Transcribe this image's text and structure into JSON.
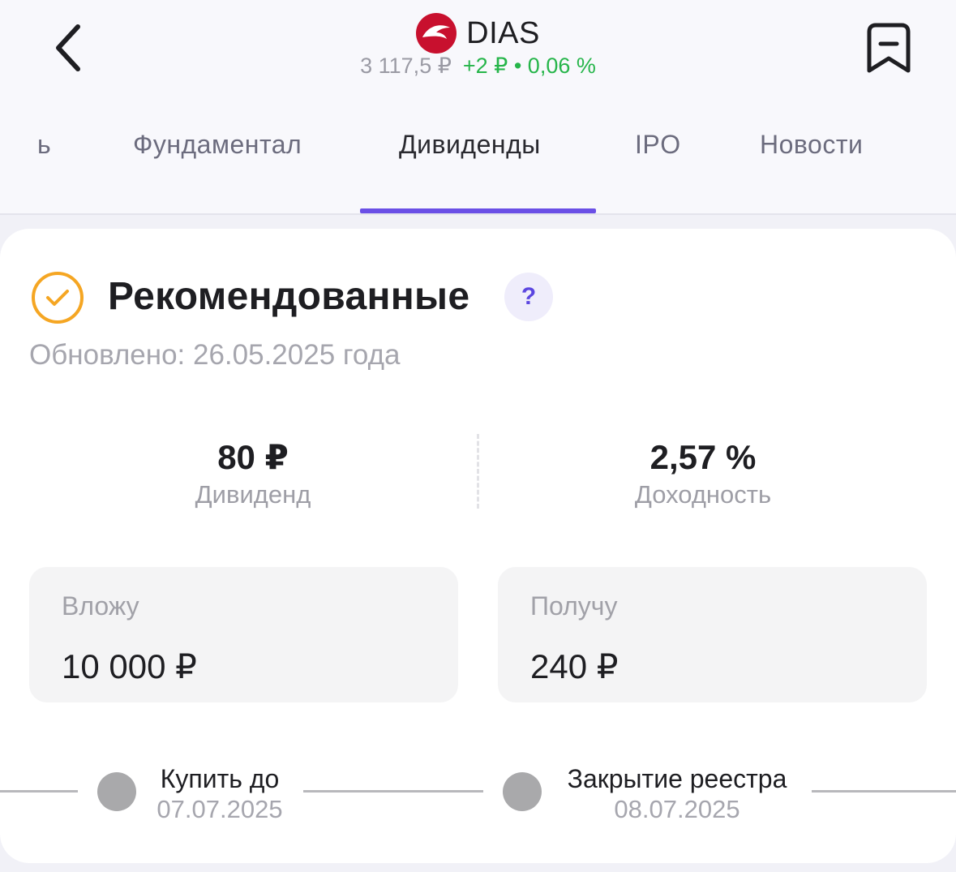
{
  "header": {
    "ticker": "DIAS",
    "price": "3 117,5 ₽",
    "change": "+2 ₽ • 0,06 %",
    "colors": {
      "change": "#26b54a",
      "logo": "#c8102e",
      "accent": "#6a4fe6"
    }
  },
  "tabs": [
    {
      "label": "ь",
      "active": false
    },
    {
      "label": "Фундаментал",
      "active": false
    },
    {
      "label": "Дивиденды",
      "active": true
    },
    {
      "label": "IPO",
      "active": false
    },
    {
      "label": "Новости",
      "active": false
    }
  ],
  "card": {
    "title": "Рекомендованные",
    "help": "?",
    "updated": "Обновлено: 26.05.2025 года",
    "dividend": {
      "value": "80 ₽",
      "label": "Дивиденд"
    },
    "yield": {
      "value": "2,57 %",
      "label": "Доходность"
    },
    "invest": {
      "label": "Вложу",
      "value": "10 000 ₽"
    },
    "receive": {
      "label": "Получу",
      "value": "240 ₽"
    },
    "timeline": [
      {
        "title": "Купить до",
        "date": "07.07.2025"
      },
      {
        "title": "Закрытие реестра",
        "date": "08.07.2025"
      }
    ]
  },
  "icons": {
    "back": "chevron-left-icon",
    "bookmark": "bookmark-minus-icon",
    "check": "check-circle-icon",
    "logo": "dolphin-logo-icon"
  }
}
